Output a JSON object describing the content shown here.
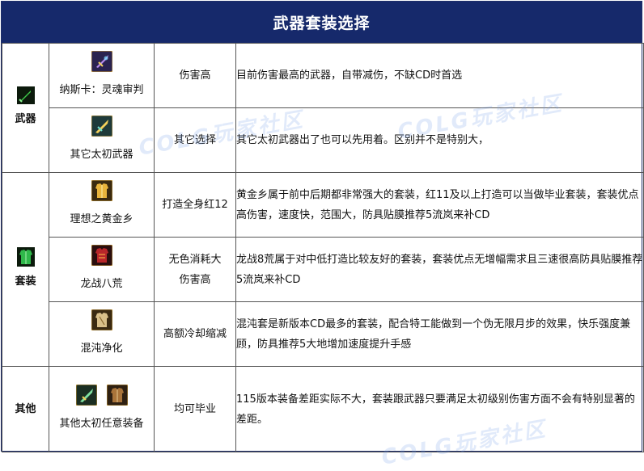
{
  "title": "武器套装选择",
  "watermark": "COLG玩家社区",
  "categories": {
    "weapon": {
      "label": "武器",
      "icon": "green-sword-icon",
      "items": [
        {
          "name": "纳斯卡：灵魂审判",
          "icon": "purple-sword-icon",
          "tag": "伤害高",
          "desc": "目前伤害最高的武器，自带减伤，不缺CD时首选"
        },
        {
          "name": "其它太初武器",
          "icon": "golden-sword-icon",
          "tag": "其它选择",
          "desc": "其它太初武器出了也可以先用着。区别并不是特别大，"
        }
      ]
    },
    "armor": {
      "label": "套装",
      "icon": "green-armor-icon",
      "items": [
        {
          "name": "理想之黄金乡",
          "icon": "gold-armor-icon",
          "tag": "打造全身红12",
          "desc": "黄金乡属于前中后期都非常强大的套装，红11及以上打造可以当做毕业套装，套装优点高伤害，速度快，范围大，防具贴膜推荐5流岚来补CD"
        },
        {
          "name": "龙战八荒",
          "icon": "red-armor-icon",
          "tag": "无色消耗大伤害高",
          "tag_line1": "无色消耗大",
          "tag_line2": "伤害高",
          "desc": "龙战8荒属于对中低打造比较友好的套装，套装优点无增幅需求且三速很高防具贴膜推荐5流岚来补CD"
        },
        {
          "name": "混沌净化",
          "icon": "chaos-armor-icon",
          "tag": "高额冷却缩减",
          "desc": "混沌套是新版本CD最多的套装，配合特工能做到一个伪无限月步的效果，快乐强度兼顾，防具推荐5大地增加速度提升手感"
        }
      ]
    },
    "other": {
      "label": "其他",
      "items": [
        {
          "name": "其他太初任意装备",
          "icons": [
            "green-blade-icon",
            "bronze-armor-icon"
          ],
          "tag": "均可毕业",
          "desc": "115版本装备差距实际不大，套装跟武器只要满足太初级别伤害方面不会有特别显著的差距。"
        }
      ]
    }
  }
}
